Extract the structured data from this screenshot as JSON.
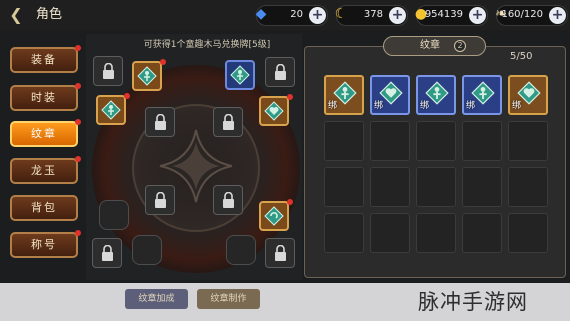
{
  "header": {
    "title": "角色",
    "back_icon": "back-arrow-icon"
  },
  "currencies": [
    {
      "name": "diamond",
      "value": "20",
      "icon": "blue-crystal-icon"
    },
    {
      "name": "energy",
      "value": "378",
      "icon": "yellow-swirl-icon"
    },
    {
      "name": "gold",
      "value": "954139",
      "icon": "gold-coin-icon"
    },
    {
      "name": "stamina",
      "value": "160/120",
      "icon": "wing-icon"
    }
  ],
  "menu": [
    {
      "label": "装备",
      "badge": true
    },
    {
      "label": "时装",
      "badge": true
    },
    {
      "label": "纹章",
      "badge": true,
      "active": true
    },
    {
      "label": "龙玉",
      "badge": true
    },
    {
      "label": "背包",
      "badge": false
    },
    {
      "label": "称号",
      "badge": true
    }
  ],
  "plate": {
    "hint": "可获得1个童趣木马兑换牌[5级]"
  },
  "inventory": {
    "tab_label": "纹章",
    "help_label": "2",
    "count": "5/50",
    "bind_label": "绑",
    "items": [
      {
        "frame": "orange",
        "icon": "green-figure-emblem-icon"
      },
      {
        "frame": "blue",
        "icon": "heart-emblem-icon"
      },
      {
        "frame": "blue",
        "icon": "green-figure-emblem-icon"
      },
      {
        "frame": "blue",
        "icon": "green-figure-emblem-icon"
      },
      {
        "frame": "orange",
        "icon": "heart-emblem-icon"
      }
    ]
  },
  "bottom": {
    "add_label": "纹章加成",
    "make_label": "纹章制作",
    "watermark": "脉冲手游网"
  },
  "colors": {
    "active_menu": "#f08a10",
    "menu_bg": "#5a2d15",
    "badge": "#e0322b"
  }
}
